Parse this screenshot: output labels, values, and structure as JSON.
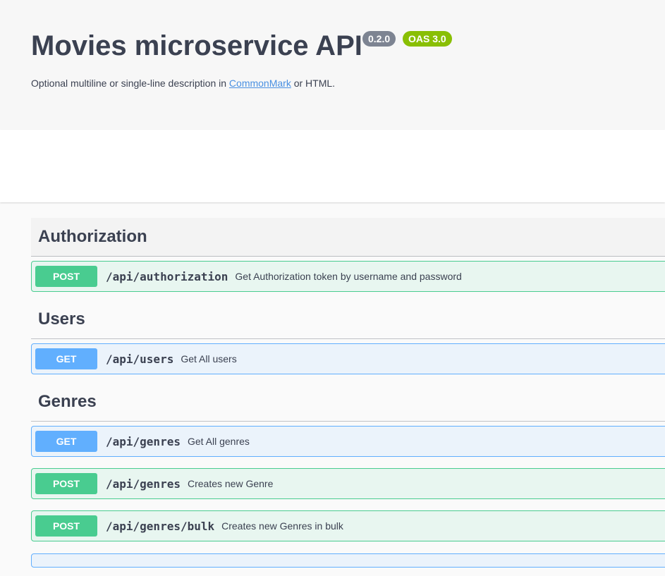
{
  "info": {
    "title": "Movies microservice API",
    "version": "0.2.0",
    "oas": "OAS 3.0",
    "description_prefix": "Optional multiline or single-line description in ",
    "description_link": "CommonMark",
    "description_suffix": " or HTML."
  },
  "tags": [
    {
      "name": "Authorization",
      "operations": [
        {
          "method": "POST",
          "path": "/api/authorization",
          "summary": "Get Authorization token by username and password"
        }
      ]
    },
    {
      "name": "Users",
      "operations": [
        {
          "method": "GET",
          "path": "/api/users",
          "summary": "Get All users"
        }
      ]
    },
    {
      "name": "Genres",
      "operations": [
        {
          "method": "GET",
          "path": "/api/genres",
          "summary": "Get All genres"
        },
        {
          "method": "POST",
          "path": "/api/genres",
          "summary": "Creates new Genre"
        },
        {
          "method": "POST",
          "path": "/api/genres/bulk",
          "summary": "Creates new Genres in bulk"
        }
      ]
    }
  ],
  "colors": {
    "post": "#49cc90",
    "get": "#61affe",
    "version_badge": "#7d8492",
    "oas_badge": "#89bf04",
    "link": "#4990e2"
  }
}
